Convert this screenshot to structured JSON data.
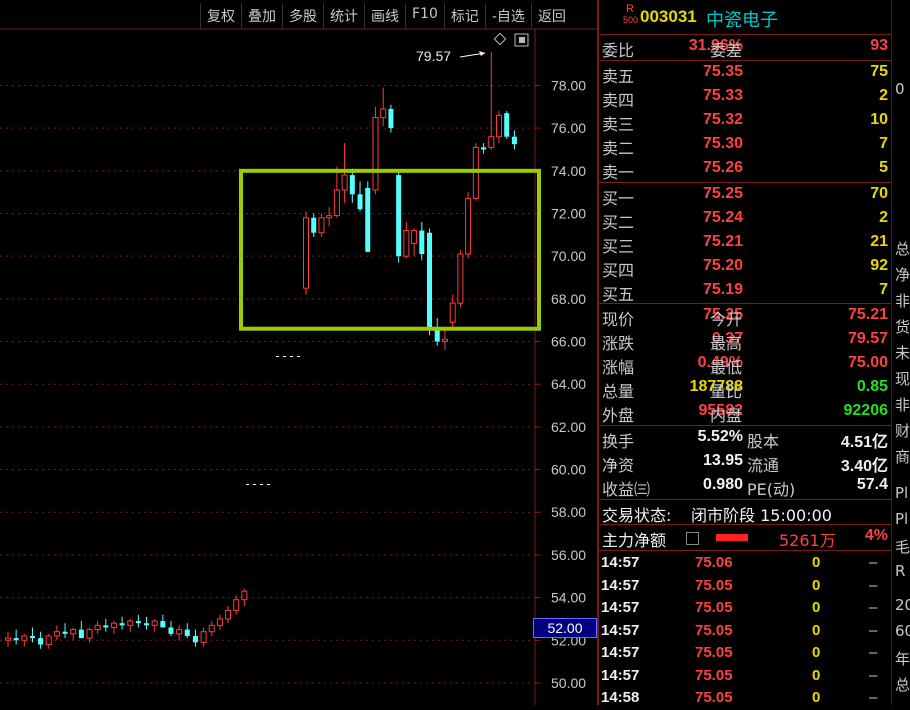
{
  "toolbar": {
    "buttons": [
      "复权",
      "叠加",
      "多股",
      "统计",
      "画线",
      "F10",
      "标记",
      "-自选",
      "返回"
    ]
  },
  "chart_data": {
    "type": "candlestick",
    "y_ticks": [
      "78.00",
      "76.00",
      "74.00",
      "72.00",
      "70.00",
      "68.00",
      "66.00",
      "64.00",
      "62.00",
      "60.00",
      "58.00",
      "56.00",
      "54.00",
      "52.00",
      "50.00"
    ],
    "y_range": [
      49.2,
      80.6
    ],
    "high_annotation": "79.57",
    "current_price_tag": "52.00",
    "highlight_box": {
      "low": 66.6,
      "high": 74.0,
      "color": "#9acd00"
    },
    "gap_marks": [
      65.3,
      59.3
    ],
    "candles": [
      {
        "o": 52.0,
        "h": 52.4,
        "l": 51.7,
        "c": 52.1
      },
      {
        "o": 52.1,
        "h": 52.5,
        "l": 51.8,
        "c": 52.0
      },
      {
        "o": 52.0,
        "h": 52.3,
        "l": 51.7,
        "c": 52.2
      },
      {
        "o": 52.2,
        "h": 52.6,
        "l": 51.9,
        "c": 52.1
      },
      {
        "o": 52.1,
        "h": 52.4,
        "l": 51.6,
        "c": 51.8
      },
      {
        "o": 51.8,
        "h": 52.3,
        "l": 51.6,
        "c": 52.2
      },
      {
        "o": 52.2,
        "h": 52.7,
        "l": 52.0,
        "c": 52.4
      },
      {
        "o": 52.4,
        "h": 52.8,
        "l": 52.1,
        "c": 52.3
      },
      {
        "o": 52.3,
        "h": 52.6,
        "l": 52.0,
        "c": 52.5
      },
      {
        "o": 52.5,
        "h": 52.9,
        "l": 52.2,
        "c": 52.1
      },
      {
        "o": 52.1,
        "h": 52.6,
        "l": 51.9,
        "c": 52.5
      },
      {
        "o": 52.5,
        "h": 52.9,
        "l": 52.3,
        "c": 52.7
      },
      {
        "o": 52.7,
        "h": 53.0,
        "l": 52.4,
        "c": 52.6
      },
      {
        "o": 52.6,
        "h": 52.9,
        "l": 52.3,
        "c": 52.8
      },
      {
        "o": 52.8,
        "h": 53.1,
        "l": 52.5,
        "c": 52.7
      },
      {
        "o": 52.7,
        "h": 53.0,
        "l": 52.4,
        "c": 52.9
      },
      {
        "o": 52.9,
        "h": 53.2,
        "l": 52.6,
        "c": 52.8
      },
      {
        "o": 52.8,
        "h": 53.1,
        "l": 52.5,
        "c": 52.7
      },
      {
        "o": 52.7,
        "h": 53.0,
        "l": 52.4,
        "c": 52.9
      },
      {
        "o": 52.9,
        "h": 53.2,
        "l": 52.6,
        "c": 52.6
      },
      {
        "o": 52.6,
        "h": 52.9,
        "l": 52.2,
        "c": 52.3
      },
      {
        "o": 52.3,
        "h": 52.7,
        "l": 52.0,
        "c": 52.5
      },
      {
        "o": 52.5,
        "h": 52.8,
        "l": 52.1,
        "c": 52.2
      },
      {
        "o": 52.2,
        "h": 52.5,
        "l": 51.7,
        "c": 51.9
      },
      {
        "o": 51.9,
        "h": 52.6,
        "l": 51.7,
        "c": 52.4
      },
      {
        "o": 52.4,
        "h": 52.9,
        "l": 52.2,
        "c": 52.7
      },
      {
        "o": 52.7,
        "h": 53.2,
        "l": 52.5,
        "c": 53.0
      },
      {
        "o": 53.0,
        "h": 53.6,
        "l": 52.8,
        "c": 53.4
      },
      {
        "o": 53.4,
        "h": 54.1,
        "l": 53.2,
        "c": 53.9
      },
      {
        "o": 53.9,
        "h": 54.4,
        "l": 53.6,
        "c": 54.3
      },
      {
        "o": 68.5,
        "h": 72.1,
        "l": 68.2,
        "c": 71.8
      },
      {
        "o": 71.8,
        "h": 72.0,
        "l": 70.9,
        "c": 71.1
      },
      {
        "o": 71.1,
        "h": 72.0,
        "l": 70.9,
        "c": 71.8
      },
      {
        "o": 71.8,
        "h": 72.3,
        "l": 71.4,
        "c": 71.9
      },
      {
        "o": 71.9,
        "h": 74.2,
        "l": 71.8,
        "c": 73.1
      },
      {
        "o": 73.1,
        "h": 75.3,
        "l": 72.5,
        "c": 73.8
      },
      {
        "o": 73.8,
        "h": 74.1,
        "l": 72.5,
        "c": 72.9
      },
      {
        "o": 72.9,
        "h": 73.5,
        "l": 72.1,
        "c": 72.2
      },
      {
        "o": 73.2,
        "h": 73.5,
        "l": 70.2,
        "c": 70.2
      },
      {
        "o": 73.1,
        "h": 77.0,
        "l": 72.9,
        "c": 76.5
      },
      {
        "o": 76.5,
        "h": 77.9,
        "l": 76.1,
        "c": 76.9
      },
      {
        "o": 76.9,
        "h": 77.1,
        "l": 75.8,
        "c": 76.0
      },
      {
        "o": 73.8,
        "h": 74.0,
        "l": 69.7,
        "c": 70.0
      },
      {
        "o": 70.0,
        "h": 71.6,
        "l": 69.9,
        "c": 71.2
      },
      {
        "o": 70.6,
        "h": 71.3,
        "l": 70.0,
        "c": 71.2
      },
      {
        "o": 71.2,
        "h": 71.6,
        "l": 69.8,
        "c": 70.1
      },
      {
        "o": 71.1,
        "h": 71.3,
        "l": 66.3,
        "c": 66.6
      },
      {
        "o": 66.6,
        "h": 67.1,
        "l": 65.8,
        "c": 66.0
      },
      {
        "o": 66.0,
        "h": 66.6,
        "l": 65.6,
        "c": 66.1
      },
      {
        "o": 66.9,
        "h": 68.2,
        "l": 66.6,
        "c": 67.8
      },
      {
        "o": 67.8,
        "h": 70.3,
        "l": 67.6,
        "c": 70.1
      },
      {
        "o": 70.1,
        "h": 73.0,
        "l": 69.9,
        "c": 72.7
      },
      {
        "o": 72.7,
        "h": 75.3,
        "l": 72.6,
        "c": 75.1
      },
      {
        "o": 75.1,
        "h": 75.3,
        "l": 74.8,
        "c": 75.0
      },
      {
        "o": 75.1,
        "h": 79.57,
        "l": 75.0,
        "c": 75.6
      },
      {
        "o": 75.6,
        "h": 76.8,
        "l": 75.3,
        "c": 76.6
      },
      {
        "o": 76.7,
        "h": 76.8,
        "l": 75.5,
        "c": 75.6
      },
      {
        "o": 75.6,
        "h": 75.9,
        "l": 75.0,
        "c": 75.25
      }
    ]
  },
  "panel": {
    "header": {
      "badge_top": "R",
      "badge_bottom": "500",
      "code": "003031",
      "name": "中瓷电子"
    },
    "weibi": {
      "label": "委比",
      "value": "31.96%",
      "label2": "委差",
      "value2": "93"
    },
    "asks": [
      {
        "label": "卖五",
        "price": "75.35",
        "vol": "75"
      },
      {
        "label": "卖四",
        "price": "75.33",
        "vol": "2"
      },
      {
        "label": "卖三",
        "price": "75.32",
        "vol": "10"
      },
      {
        "label": "卖二",
        "price": "75.30",
        "vol": "7"
      },
      {
        "label": "卖一",
        "price": "75.26",
        "vol": "5"
      }
    ],
    "bids": [
      {
        "label": "买一",
        "price": "75.25",
        "vol": "70"
      },
      {
        "label": "买二",
        "price": "75.24",
        "vol": "2"
      },
      {
        "label": "买三",
        "price": "75.21",
        "vol": "21"
      },
      {
        "label": "买四",
        "price": "75.20",
        "vol": "92"
      },
      {
        "label": "买五",
        "price": "75.19",
        "vol": "7"
      }
    ],
    "quote": [
      {
        "l1": "现价",
        "v1": "75.25",
        "c1": "red",
        "l2": "今开",
        "v2": "75.21",
        "c2": "red"
      },
      {
        "l1": "涨跌",
        "v1": "0.37",
        "c1": "red",
        "l2": "最高",
        "v2": "79.57",
        "c2": "red"
      },
      {
        "l1": "涨幅",
        "v1": "0.49%",
        "c1": "red",
        "l2": "最低",
        "v2": "75.00",
        "c2": "red"
      },
      {
        "l1": "总量",
        "v1": "187788",
        "c1": "yellow",
        "l2": "量比",
        "v2": "0.85",
        "c2": "green"
      },
      {
        "l1": "外盘",
        "v1": "95582",
        "c1": "red",
        "l2": "内盘",
        "v2": "92206",
        "c2": "green"
      }
    ],
    "fundamentals": [
      {
        "l1": "换手",
        "v1": "5.52%",
        "l2": "股本",
        "v2": "4.51亿"
      },
      {
        "l1": "净资",
        "v1": "13.95",
        "l2": "流通",
        "v2": "3.40亿"
      },
      {
        "l1": "收益㈢",
        "v1": "0.980",
        "l2": "PE(动)",
        "v2": "57.4"
      }
    ],
    "status": {
      "label": "交易状态:",
      "value": "闭市阶段 15:00:00"
    },
    "mainforce": {
      "label": "主力净额",
      "value": "5261万",
      "pct": "4%"
    },
    "ticks": [
      {
        "time": "14:57",
        "price": "75.06",
        "vol": "0",
        "dir": "–"
      },
      {
        "time": "14:57",
        "price": "75.05",
        "vol": "0",
        "dir": "–"
      },
      {
        "time": "14:57",
        "price": "75.05",
        "vol": "0",
        "dir": "–"
      },
      {
        "time": "14:57",
        "price": "75.05",
        "vol": "0",
        "dir": "–"
      },
      {
        "time": "14:57",
        "price": "75.05",
        "vol": "0",
        "dir": "–"
      },
      {
        "time": "14:57",
        "price": "75.05",
        "vol": "0",
        "dir": "–"
      },
      {
        "time": "14:58",
        "price": "75.05",
        "vol": "0",
        "dir": "–"
      }
    ]
  },
  "edge_chars": [
    "0",
    "总",
    "净",
    "非",
    "货",
    "未",
    "现",
    "非",
    "财",
    "商",
    "Pl",
    "Pl",
    "毛",
    "R",
    "20",
    "60",
    "年",
    "总"
  ]
}
